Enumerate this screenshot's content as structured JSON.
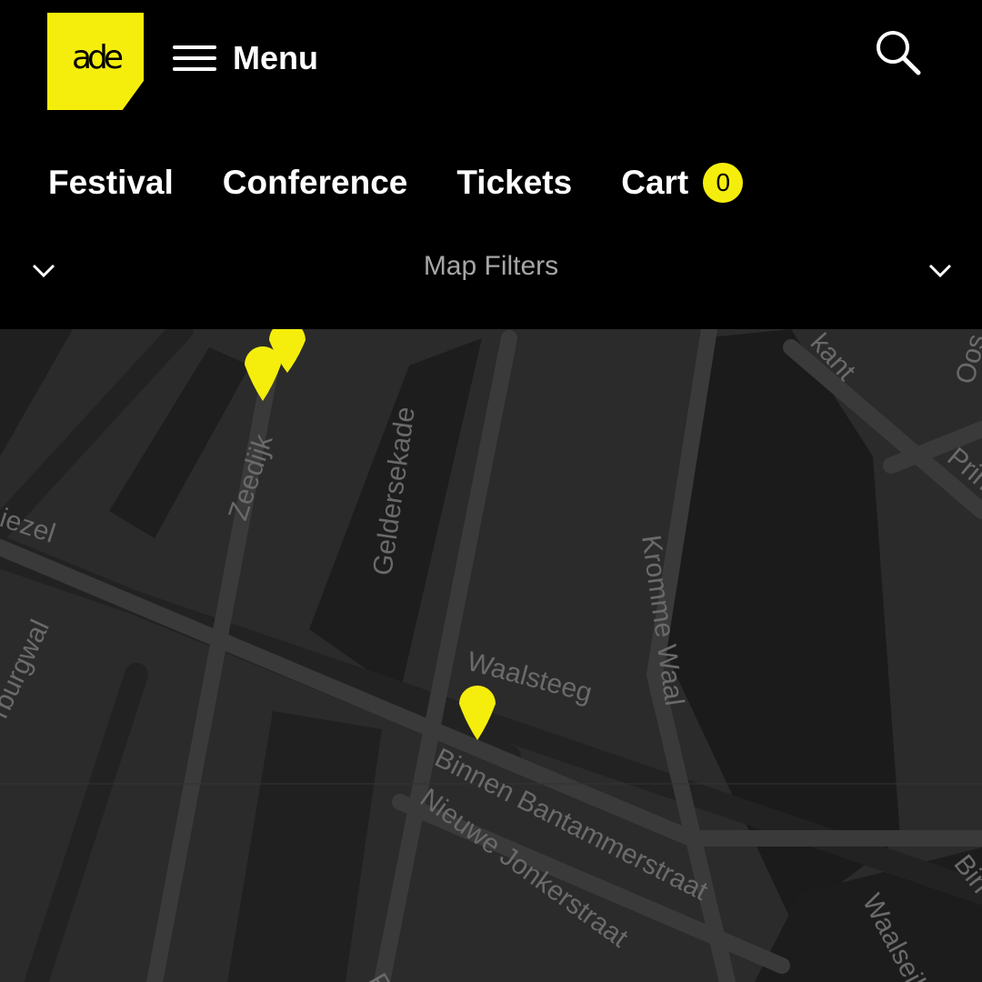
{
  "header": {
    "logo_text": "ade",
    "menu_label": "Menu",
    "search_icon": "search-icon"
  },
  "nav": {
    "festival": "Festival",
    "conference": "Conference",
    "tickets": "Tickets",
    "cart": "Cart",
    "cart_count": "0"
  },
  "filters": {
    "label": "Map Filters"
  },
  "map": {
    "streets": {
      "zeedijk": "Zeedijk",
      "geldersekade": "Geldersekade",
      "kromme_waal": "Kromme Waal",
      "waalsteeg": "Waalsteeg",
      "binnen_bantammerstraat": "Binnen Bantammerstraat",
      "nieuwe_jonkerstraat": "Nieuwe Jonkerstraat",
      "kant_partial": "kant",
      "prin_partial": "Prin",
      "oos_partial": "Oos",
      "iezel_partial": "iezel",
      "burgwal_partial": "rburgwal",
      "waalseil_partial": "Waalseil",
      "bin_partial": "Bin",
      "re_partial": "Re"
    }
  },
  "colors": {
    "accent": "#f5ee0c",
    "background": "#000000",
    "map_bg": "#2b2b2b"
  }
}
